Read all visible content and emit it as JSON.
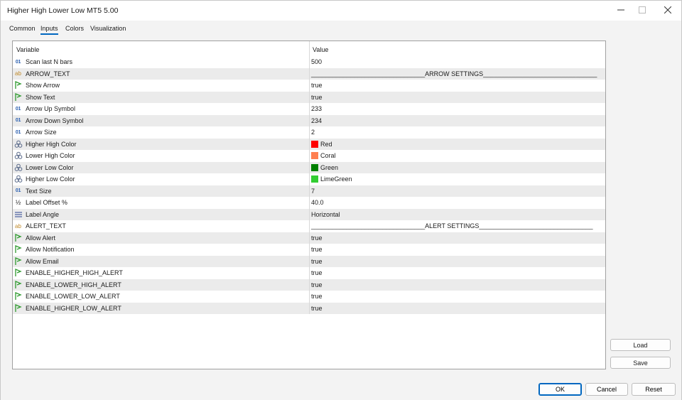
{
  "window": {
    "title": "Higher High Lower Low MT5 5.00"
  },
  "tabs": [
    {
      "label": "Common"
    },
    {
      "label": "Inputs"
    },
    {
      "label": "Colors"
    },
    {
      "label": "Visualization"
    }
  ],
  "active_tab": "Inputs",
  "grid": {
    "headers": {
      "variable": "Variable",
      "value": "Value"
    },
    "rows": [
      {
        "icon": "int",
        "variable": "Scan last N bars",
        "value": "500"
      },
      {
        "icon": "string",
        "variable": "ARROW_TEXT",
        "value": "________________________________ARROW SETTINGS________________________________"
      },
      {
        "icon": "bool",
        "variable": "Show Arrow",
        "value": "true"
      },
      {
        "icon": "bool",
        "variable": "Show Text",
        "value": "true"
      },
      {
        "icon": "int",
        "variable": "Arrow Up Symbol",
        "value": "233"
      },
      {
        "icon": "int",
        "variable": "Arrow Down Symbol",
        "value": "234"
      },
      {
        "icon": "int",
        "variable": "Arrow Size",
        "value": "2"
      },
      {
        "icon": "color",
        "variable": "Higher High Color",
        "value": "Red",
        "swatch": "#ff0000"
      },
      {
        "icon": "color",
        "variable": "Lower High Color",
        "value": "Coral",
        "swatch": "#ff7f50"
      },
      {
        "icon": "color",
        "variable": "Lower Low Color",
        "value": "Green",
        "swatch": "#008000"
      },
      {
        "icon": "color",
        "variable": "Higher Low Color",
        "value": "LimeGreen",
        "swatch": "#32cd32"
      },
      {
        "icon": "int",
        "variable": "Text Size",
        "value": "7"
      },
      {
        "icon": "double",
        "variable": "Label Offset %",
        "value": "40.0"
      },
      {
        "icon": "enum",
        "variable": "Label Angle",
        "value": "Horizontal"
      },
      {
        "icon": "string",
        "variable": "ALERT_TEXT",
        "value": "________________________________ALERT SETTINGS________________________________"
      },
      {
        "icon": "bool",
        "variable": "Allow Alert",
        "value": "true"
      },
      {
        "icon": "bool",
        "variable": "Allow Notification",
        "value": "true"
      },
      {
        "icon": "bool",
        "variable": "Allow Email",
        "value": "true"
      },
      {
        "icon": "bool",
        "variable": "ENABLE_HIGHER_HIGH_ALERT",
        "value": "true"
      },
      {
        "icon": "bool",
        "variable": "ENABLE_LOWER_HIGH_ALERT",
        "value": "true"
      },
      {
        "icon": "bool",
        "variable": "ENABLE_LOWER_LOW_ALERT",
        "value": "true"
      },
      {
        "icon": "bool",
        "variable": "ENABLE_HIGHER_LOW_ALERT",
        "value": "true"
      }
    ]
  },
  "side_buttons": {
    "load": "Load",
    "save": "Save"
  },
  "footer": {
    "ok": "OK",
    "cancel": "Cancel",
    "reset": "Reset"
  },
  "colors": {
    "accent": "#0067c0",
    "row_alt": "#ebebeb",
    "border": "#a0a0a0"
  }
}
